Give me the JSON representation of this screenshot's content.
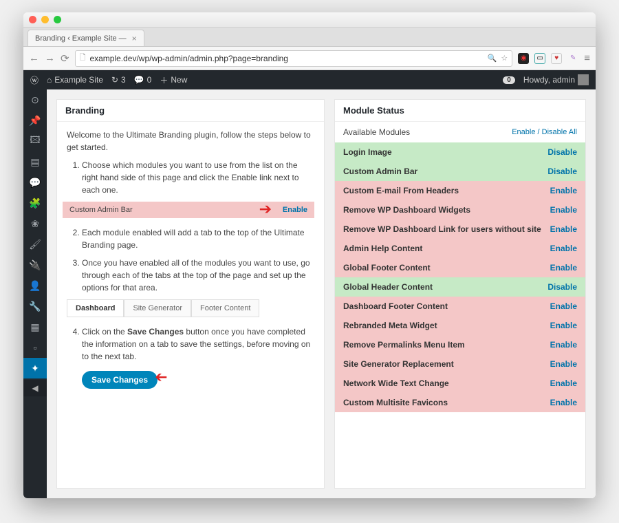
{
  "browser": {
    "tab_title": "Branding ‹ Example Site —",
    "url": "example.dev/wp/wp-admin/admin.php?page=branding"
  },
  "adminbar": {
    "site_name": "Example Site",
    "refresh_count": "3",
    "comments_count": "0",
    "new_label": "New",
    "notif_badge": "0",
    "howdy": "Howdy, admin"
  },
  "left_panel": {
    "title": "Branding",
    "intro": "Welcome to the Ultimate Branding plugin, follow the steps below to get started.",
    "step1": "Choose which modules you want to use from the list on the right hand side of this page and click the Enable link next to each one.",
    "example_module": "Custom Admin Bar",
    "example_action": "Enable",
    "step2": "Each module enabled will add a tab to the top of the Ultimate Branding page.",
    "step3": "Once you have enabled all of the modules you want to use, go through each of the tabs at the top of the page and set up the options for that area.",
    "tabs": [
      "Dashboard",
      "Site Generator",
      "Footer Content"
    ],
    "step4_a": "Click on the ",
    "step4_bold": "Save Changes",
    "step4_b": " button once you have completed the information on a tab to save the settings, before moving on to the next tab.",
    "save_button": "Save Changes"
  },
  "right_panel": {
    "title": "Module Status",
    "available": "Available Modules",
    "enable_link": "Enable",
    "divider": " / ",
    "disable_all": "Disable All",
    "modules": [
      {
        "name": "Login Image",
        "enabled": true,
        "action": "Disable"
      },
      {
        "name": "Custom Admin Bar",
        "enabled": true,
        "action": "Disable"
      },
      {
        "name": "Custom E-mail From Headers",
        "enabled": false,
        "action": "Enable"
      },
      {
        "name": "Remove WP Dashboard Widgets",
        "enabled": false,
        "action": "Enable"
      },
      {
        "name": "Remove WP Dashboard Link for users without site",
        "enabled": false,
        "action": "Enable"
      },
      {
        "name": "Admin Help Content",
        "enabled": false,
        "action": "Enable"
      },
      {
        "name": "Global Footer Content",
        "enabled": false,
        "action": "Enable"
      },
      {
        "name": "Global Header Content",
        "enabled": true,
        "action": "Disable"
      },
      {
        "name": "Dashboard Footer Content",
        "enabled": false,
        "action": "Enable"
      },
      {
        "name": "Rebranded Meta Widget",
        "enabled": false,
        "action": "Enable"
      },
      {
        "name": "Remove Permalinks Menu Item",
        "enabled": false,
        "action": "Enable"
      },
      {
        "name": "Site Generator Replacement",
        "enabled": false,
        "action": "Enable"
      },
      {
        "name": "Network Wide Text Change",
        "enabled": false,
        "action": "Enable"
      },
      {
        "name": "Custom Multisite Favicons",
        "enabled": false,
        "action": "Enable"
      }
    ]
  }
}
